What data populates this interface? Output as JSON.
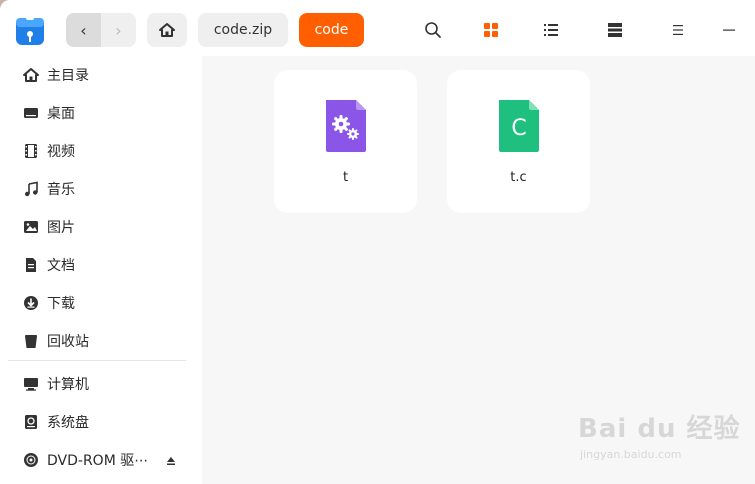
{
  "toolbar": {
    "back_glyph": "‹",
    "forward_glyph": "›",
    "breadcrumbs": [
      "code.zip",
      "code"
    ]
  },
  "sidebar": {
    "items": [
      {
        "label": "主目录",
        "icon": "home-icon"
      },
      {
        "label": "桌面",
        "icon": "desktop-icon"
      },
      {
        "label": "视频",
        "icon": "video-icon"
      },
      {
        "label": "音乐",
        "icon": "music-icon"
      },
      {
        "label": "图片",
        "icon": "picture-icon"
      },
      {
        "label": "文档",
        "icon": "document-icon"
      },
      {
        "label": "下载",
        "icon": "download-icon"
      },
      {
        "label": "回收站",
        "icon": "trash-icon"
      }
    ],
    "devices": [
      {
        "label": "计算机",
        "icon": "computer-icon"
      },
      {
        "label": "系统盘",
        "icon": "drive-icon"
      },
      {
        "label": "DVD-ROM 驱⋯",
        "icon": "disc-icon"
      }
    ]
  },
  "files": [
    {
      "name": "t",
      "icon": "executable-gear-icon",
      "color": "#8b55e8"
    },
    {
      "name": "t.c",
      "icon": "c-source-icon",
      "letter": "C",
      "color": "#1fbf7f"
    }
  ],
  "watermark": {
    "brand": "Bai du 经验",
    "url": "jingyan.baidu.com"
  },
  "colors": {
    "accent": "#ff5f00"
  }
}
